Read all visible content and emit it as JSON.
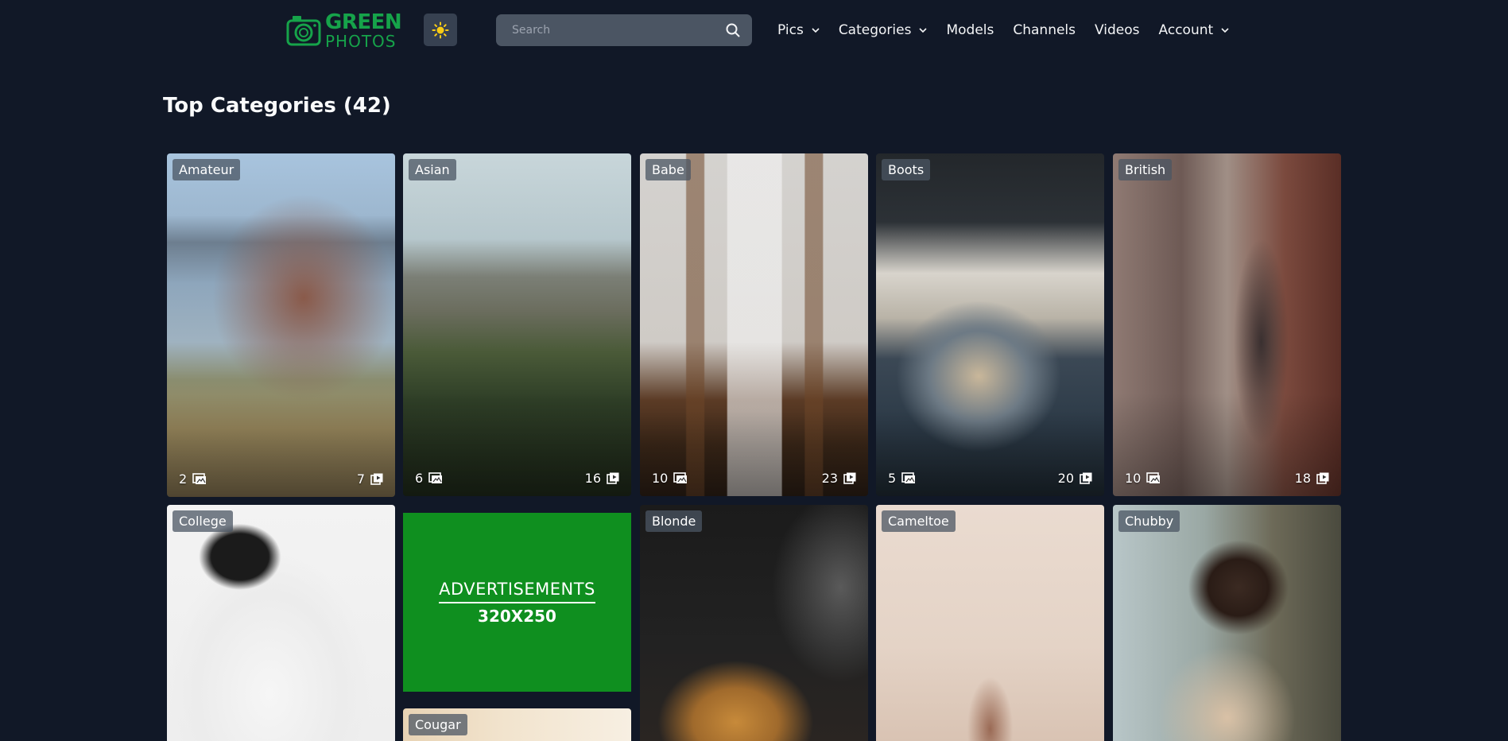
{
  "brand": {
    "line1": "GREEN",
    "line2": "PHOTOS",
    "color": "#16a34a"
  },
  "search": {
    "placeholder": "Search"
  },
  "nav": {
    "items": [
      {
        "label": "Pics",
        "dropdown": true
      },
      {
        "label": "Categories",
        "dropdown": true
      },
      {
        "label": "Models",
        "dropdown": false
      },
      {
        "label": "Channels",
        "dropdown": false
      },
      {
        "label": "Videos",
        "dropdown": false
      },
      {
        "label": "Account",
        "dropdown": true
      }
    ]
  },
  "page": {
    "title": "Top Categories (42)"
  },
  "categories": [
    {
      "name": "Amateur",
      "photos": "2",
      "videos": "7"
    },
    {
      "name": "Asian",
      "photos": "6",
      "videos": "16"
    },
    {
      "name": "Babe",
      "photos": "10",
      "videos": "23"
    },
    {
      "name": "Boots",
      "photos": "5",
      "videos": "20"
    },
    {
      "name": "British",
      "photos": "10",
      "videos": "18"
    },
    {
      "name": "College"
    },
    {
      "name": "Blonde"
    },
    {
      "name": "Cameltoe"
    },
    {
      "name": "Chubby"
    },
    {
      "name": "Cougar"
    }
  ],
  "ad": {
    "line1": "ADVERTISEMENTS",
    "line2": "320X250",
    "color": "#0f8f1f"
  },
  "icons": {
    "theme": "sun-icon",
    "search": "search-icon",
    "photos": "image-stack-icon",
    "videos": "play-stack-icon",
    "dropdown": "chevron-down-icon"
  }
}
